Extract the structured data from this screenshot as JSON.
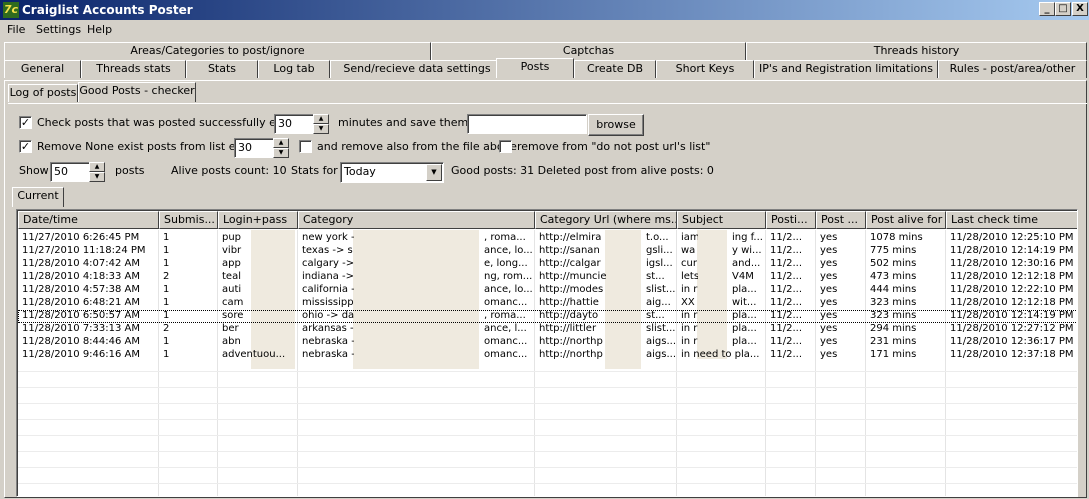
{
  "window": {
    "title": "Craiglist Accounts Poster",
    "icon_glyph": "7c",
    "minimize_glyph": "_",
    "maximize_glyph": "□",
    "close_glyph": "X"
  },
  "menu": [
    "File",
    "Settings",
    "Help"
  ],
  "tabs_row1": [
    "Areas/Categories to post/ignore",
    "Captchas",
    "Threads history"
  ],
  "tabs_row2": [
    "General",
    "Threads stats",
    "Stats",
    "Log tab",
    "Send/recieve data settings",
    "Posts",
    "Create DB",
    "Short Keys",
    "IP's and Registration limitations",
    "Rules - post/area/other"
  ],
  "subtabs": [
    "Log of posts",
    "Good Posts - checker"
  ],
  "checker": {
    "check_posts_label": "Check posts that was posted successfully every",
    "check_posts_checked": true,
    "check_posts_value": "30",
    "save_label": "minutes and save them to",
    "save_path": "",
    "browse_label": "browse",
    "remove_label": "Remove None exist posts from list every",
    "remove_checked": true,
    "remove_value": "30",
    "remove_file_label": "and remove also from the file above",
    "remove_file_checked": false,
    "remove_dnp_label": "remove from \"do not post url's list\"",
    "remove_dnp_checked": false,
    "show_label": "Show",
    "show_value": "50",
    "posts_label": "posts",
    "alive_count": "Alive posts count: 10",
    "stats_for_label": "Stats for",
    "stats_for_value": "Today",
    "good_posts_summary": "Good posts: 31 Deleted post from alive posts: 0",
    "check_mark": "✓",
    "spin_up": "▲",
    "spin_down": "▼",
    "dropdown_arrow": "▼"
  },
  "current_tab": "Current",
  "table": {
    "columns": [
      "Date/time",
      "Submis...",
      "Login+pass",
      "Category",
      "Category Url  (where ms...",
      "Subject",
      "Posti...",
      "Post ...",
      "Post alive for",
      "Last check time"
    ],
    "rows": [
      [
        "11/27/2010 6:26:45 PM",
        "1",
        "pup",
        "new york -",
        ", roma...",
        "http://elmira",
        "t.o...",
        "iam",
        "ing f...",
        "11/2...",
        "yes",
        "1078 mins",
        "11/28/2010 12:25:10 PM"
      ],
      [
        "11/27/2010 11:18:24 PM",
        "1",
        "vibr",
        "texas -> s",
        "ance, lo...",
        "http://sanan",
        "gsli...",
        "wa",
        "y wi...",
        "11/2...",
        "yes",
        "775 mins",
        "11/28/2010 12:14:19 PM"
      ],
      [
        "11/28/2010 4:07:42 AM",
        "1",
        "app",
        "calgary ->",
        "e, long...",
        "http://calgar",
        "igsl...",
        "cur",
        "and...",
        "11/2...",
        "yes",
        "502 mins",
        "11/28/2010 12:30:16 PM"
      ],
      [
        "11/28/2010 4:18:33 AM",
        "2",
        "teal",
        "indiana ->",
        "ng, rom...",
        "http://muncie",
        "st...",
        "lets",
        "V4M",
        "11/2...",
        "yes",
        "473 mins",
        "11/28/2010 12:12:18 PM"
      ],
      [
        "11/28/2010 4:57:38 AM",
        "1",
        "auti",
        "california -",
        "ance, lo...",
        "http://modes",
        "slist...",
        "in r",
        "pla...",
        "11/2...",
        "yes",
        "444 mins",
        "11/28/2010 12:22:10 PM"
      ],
      [
        "11/28/2010 6:48:21 AM",
        "1",
        "cam",
        "mississippi",
        "omanc...",
        "http://hattie",
        "aig...",
        "XX",
        "wit...",
        "11/2...",
        "yes",
        "323 mins",
        "11/28/2010 12:12:18 PM"
      ],
      [
        "11/28/2010 6:50:57 AM",
        "1",
        "sore",
        "ohio -> da",
        ", roma...",
        "http://dayto",
        "st...",
        "in r",
        "pla...",
        "11/2...",
        "yes",
        "323 mins",
        "11/28/2010 12:14:19 PM"
      ],
      [
        "11/28/2010 7:33:13 AM",
        "2",
        "ber",
        "arkansas -",
        "ance, l...",
        "http://littler",
        "slist...",
        "in r",
        "pla...",
        "11/2...",
        "yes",
        "294 mins",
        "11/28/2010 12:27:12 PM"
      ],
      [
        "11/28/2010 8:44:46 AM",
        "1",
        "abn",
        "nebraska -",
        "omanc...",
        "http://northp",
        "aigs...",
        "in r",
        "pla...",
        "11/2...",
        "yes",
        "231 mins",
        "11/28/2010 12:36:17 PM"
      ],
      [
        "11/28/2010 9:46:16 AM",
        "1",
        "adventuou...",
        "nebraska -",
        "omanc...",
        "http://northp",
        "aigs...",
        "in need to pla...",
        "",
        "11/2...",
        "yes",
        "171 mins",
        "11/28/2010 12:37:18 PM"
      ]
    ]
  }
}
